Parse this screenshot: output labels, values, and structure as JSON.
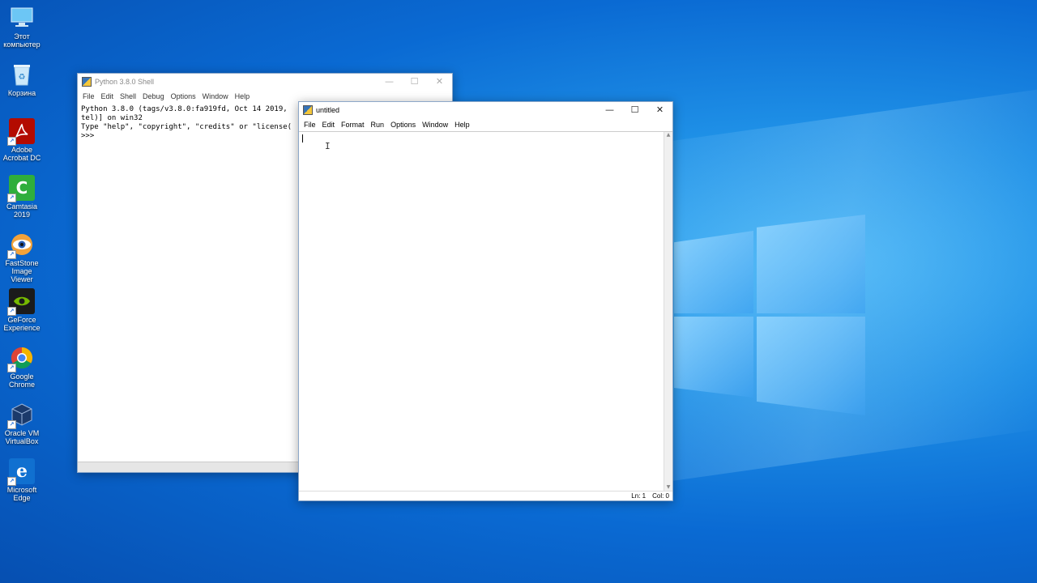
{
  "desktop": {
    "icons": [
      {
        "name": "this-pc",
        "label": "Этот компьютер",
        "icon": "computer-icon",
        "color": "#4aa3df"
      },
      {
        "name": "recycle-bin",
        "label": "Корзина",
        "icon": "recycle-bin-icon",
        "color": "#7cc3ea"
      },
      {
        "name": "adobe-acrobat",
        "label": "Adobe Acrobat DC",
        "icon": "acrobat-icon",
        "color": "#b30b00"
      },
      {
        "name": "camtasia",
        "label": "Camtasia 2019",
        "icon": "camtasia-icon",
        "color": "#2fae3c"
      },
      {
        "name": "faststone",
        "label": "FastStone Image Viewer",
        "icon": "faststone-eye-icon",
        "color": "#e8732a"
      },
      {
        "name": "geforce",
        "label": "GeForce Experience",
        "icon": "nvidia-icon",
        "color": "#76b900"
      },
      {
        "name": "chrome",
        "label": "Google Chrome",
        "icon": "chrome-icon",
        "color": "#db4437"
      },
      {
        "name": "virtualbox",
        "label": "Oracle VM VirtualBox",
        "icon": "virtualbox-icon",
        "color": "#1b3a6b"
      },
      {
        "name": "edge",
        "label": "Microsoft Edge",
        "icon": "edge-icon",
        "color": "#1070d0"
      }
    ]
  },
  "shell": {
    "title": "Python 3.8.0 Shell",
    "menu": [
      "File",
      "Edit",
      "Shell",
      "Debug",
      "Options",
      "Window",
      "Help"
    ],
    "lines": [
      "Python 3.8.0 (tags/v3.8.0:fa919fd, Oct 14 2019,",
      "tel)] on win32",
      "Type \"help\", \"copyright\", \"credits\" or \"license(",
      ">>> "
    ]
  },
  "editor": {
    "title": "untitled",
    "menu": [
      "File",
      "Edit",
      "Format",
      "Run",
      "Options",
      "Window",
      "Help"
    ],
    "status": {
      "line": "Ln: 1",
      "col": "Col: 0"
    }
  },
  "window_controls": {
    "minimize": "—",
    "maximize": "☐",
    "close": "✕"
  }
}
